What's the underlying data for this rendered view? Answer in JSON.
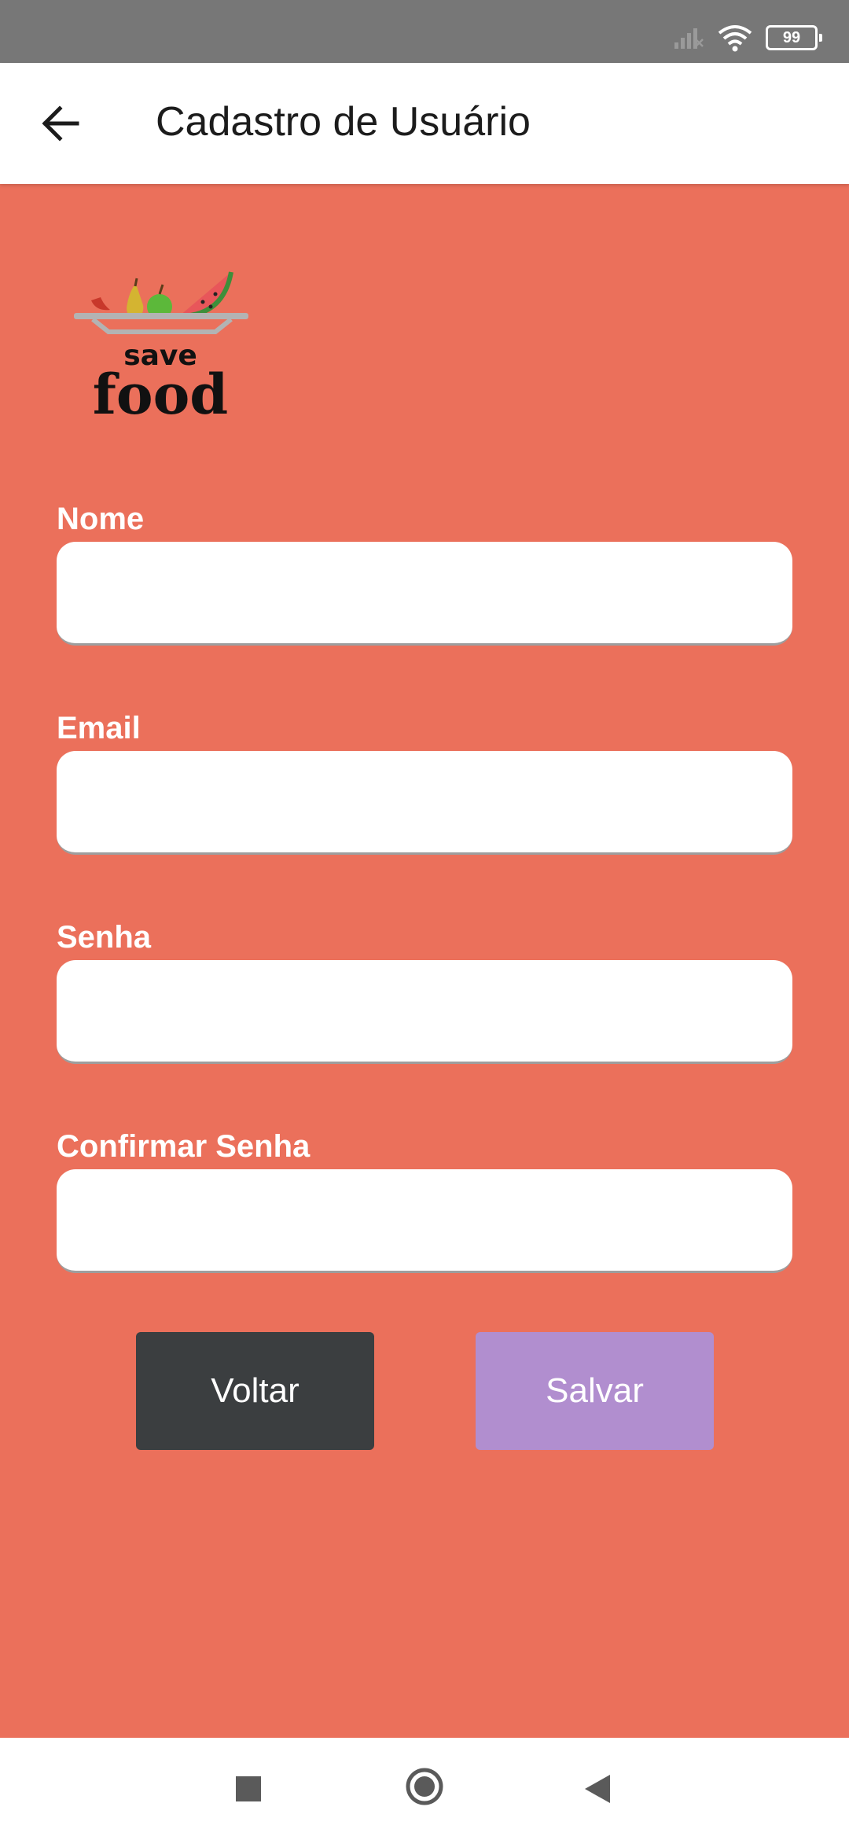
{
  "status_bar": {
    "battery_level": "99",
    "icons": [
      "signal-off-icon",
      "wifi-icon",
      "battery-icon"
    ]
  },
  "app_bar": {
    "back_icon": "arrow-left-icon",
    "title": "Cadastro de Usuário"
  },
  "logo": {
    "text_line1": "save",
    "text_line2": "food"
  },
  "form": {
    "fields": [
      {
        "label": "Nome",
        "value": "",
        "placeholder": ""
      },
      {
        "label": "Email",
        "value": "",
        "placeholder": ""
      },
      {
        "label": "Senha",
        "value": "",
        "placeholder": ""
      },
      {
        "label": "Confirmar Senha",
        "value": "",
        "placeholder": ""
      }
    ]
  },
  "buttons": {
    "back_label": "Voltar",
    "save_label": "Salvar"
  },
  "nav_bar": {
    "icons": [
      "recent-apps-icon",
      "home-icon",
      "back-icon"
    ]
  },
  "colors": {
    "background": "#eb705b",
    "status_bar": "#777777",
    "back_button": "#3b3e40",
    "save_button": "#b18ecf"
  }
}
